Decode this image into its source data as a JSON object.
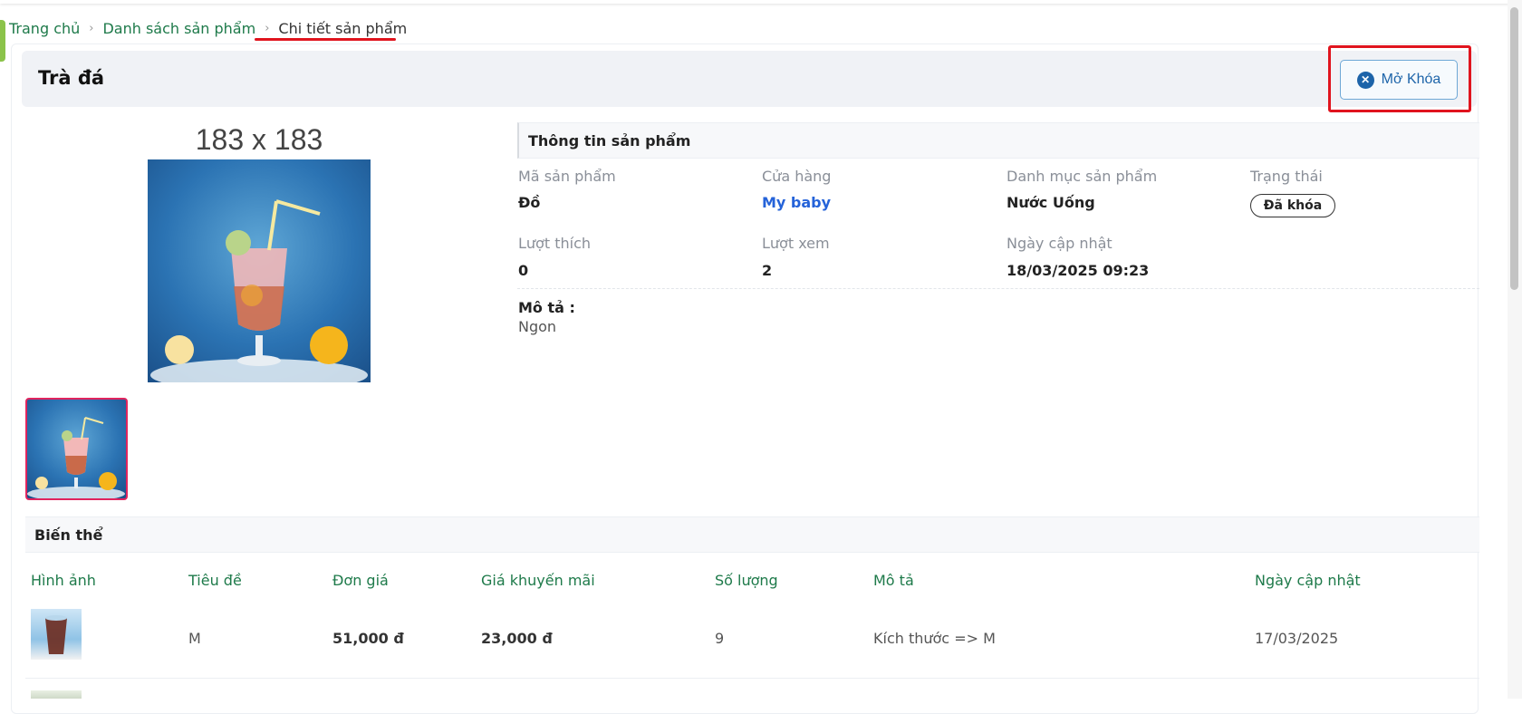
{
  "breadcrumb": {
    "home": "Trang chủ",
    "list": "Danh sách sản phẩm",
    "current": "Chi tiết sản phẩm"
  },
  "product": {
    "title": "Trà đá",
    "unlock_label": "Mở Khóa",
    "image_size_label": "183 x 183"
  },
  "info": {
    "section_title": "Thông tin sản phẩm",
    "code_label": "Mã sản phẩm",
    "code_value": "Đồ",
    "store_label": "Cửa hàng",
    "store_value": "My baby",
    "category_label": "Danh mục sản phẩm",
    "category_value": "Nước Uống",
    "status_label": "Trạng thái",
    "status_value": "Đã khóa",
    "likes_label": "Lượt thích",
    "likes_value": "0",
    "views_label": "Lượt xem",
    "views_value": "2",
    "updated_label": "Ngày cập nhật",
    "updated_value": "18/03/2025 09:23",
    "desc_label": "Mô tả :",
    "desc_value": "Ngon"
  },
  "variants": {
    "section_title": "Biến thể",
    "columns": [
      "Hình ảnh",
      "Tiêu đề",
      "Đơn giá",
      "Giá khuyến mãi",
      "Số lượng",
      "Mô tả",
      "Ngày cập nhật"
    ],
    "rows": [
      {
        "title": "M",
        "price": "51,000 đ",
        "sale_price": "23,000 đ",
        "quantity": "9",
        "description": "Kích thước => M",
        "updated": "17/03/2025"
      }
    ]
  },
  "colors": {
    "accent_green": "#1e7a4a",
    "link_blue": "#2563d9",
    "highlight_red": "#e0141e",
    "button_blue": "#1d64a9"
  }
}
